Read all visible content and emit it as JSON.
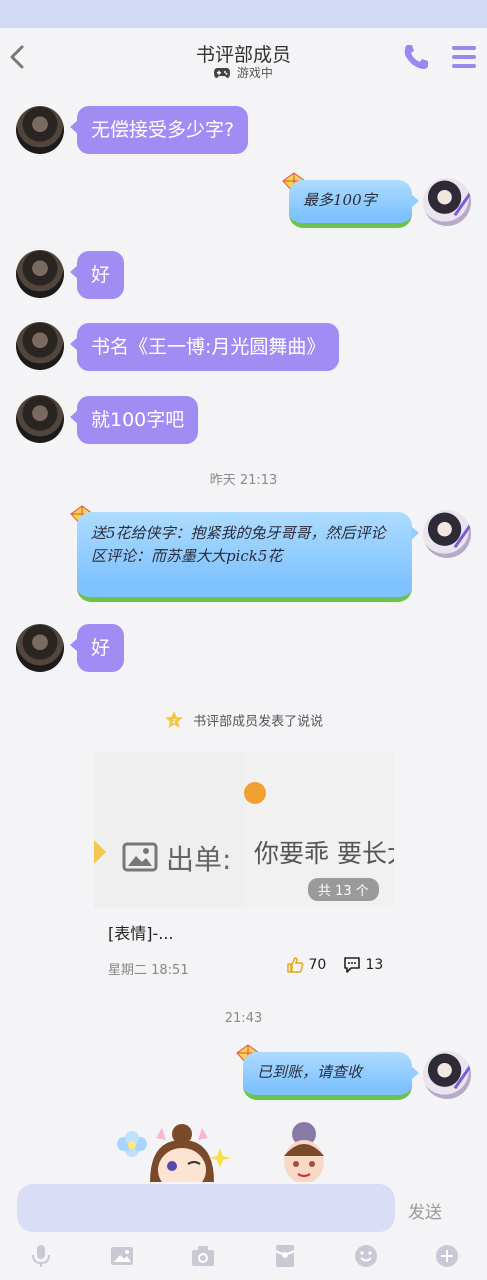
{
  "header": {
    "title": "书评部成员",
    "status": "游戏中"
  },
  "messages": [
    {
      "side": "left",
      "style": "purple",
      "text": "无偿接受多少字?"
    },
    {
      "side": "right",
      "style": "kite",
      "text": "最多100字"
    },
    {
      "side": "left",
      "style": "purple",
      "text": "好"
    },
    {
      "side": "left",
      "style": "purple",
      "text": "书名《王一博:月光圆舞曲》"
    },
    {
      "side": "left",
      "style": "purple",
      "text": "就100字吧"
    },
    {
      "side": "right",
      "style": "kite",
      "text": "送5花给侠字：抱紧我的兔牙哥哥，然后评论区评论：而苏墨大大pick5花"
    },
    {
      "side": "left",
      "style": "purple",
      "text": "好"
    },
    {
      "side": "right",
      "style": "kite",
      "text": "已到账，请查收"
    }
  ],
  "timestamps": [
    "昨天 21:13",
    "21:43"
  ],
  "shuoshuo": {
    "notice": "书评部成员发表了说说",
    "image_text_left": "出单:",
    "image_text_right": "你要乖 要长大",
    "image_count": "共 13 个",
    "caption": "[表情]-...",
    "date": "星期二 18:51",
    "likes": "70",
    "comments": "13"
  },
  "composer": {
    "send_label": "发送"
  },
  "colors": {
    "accent": "#a08cf3",
    "status_strip": "#d2d9f5",
    "kite_bubble": "#93ceff"
  }
}
